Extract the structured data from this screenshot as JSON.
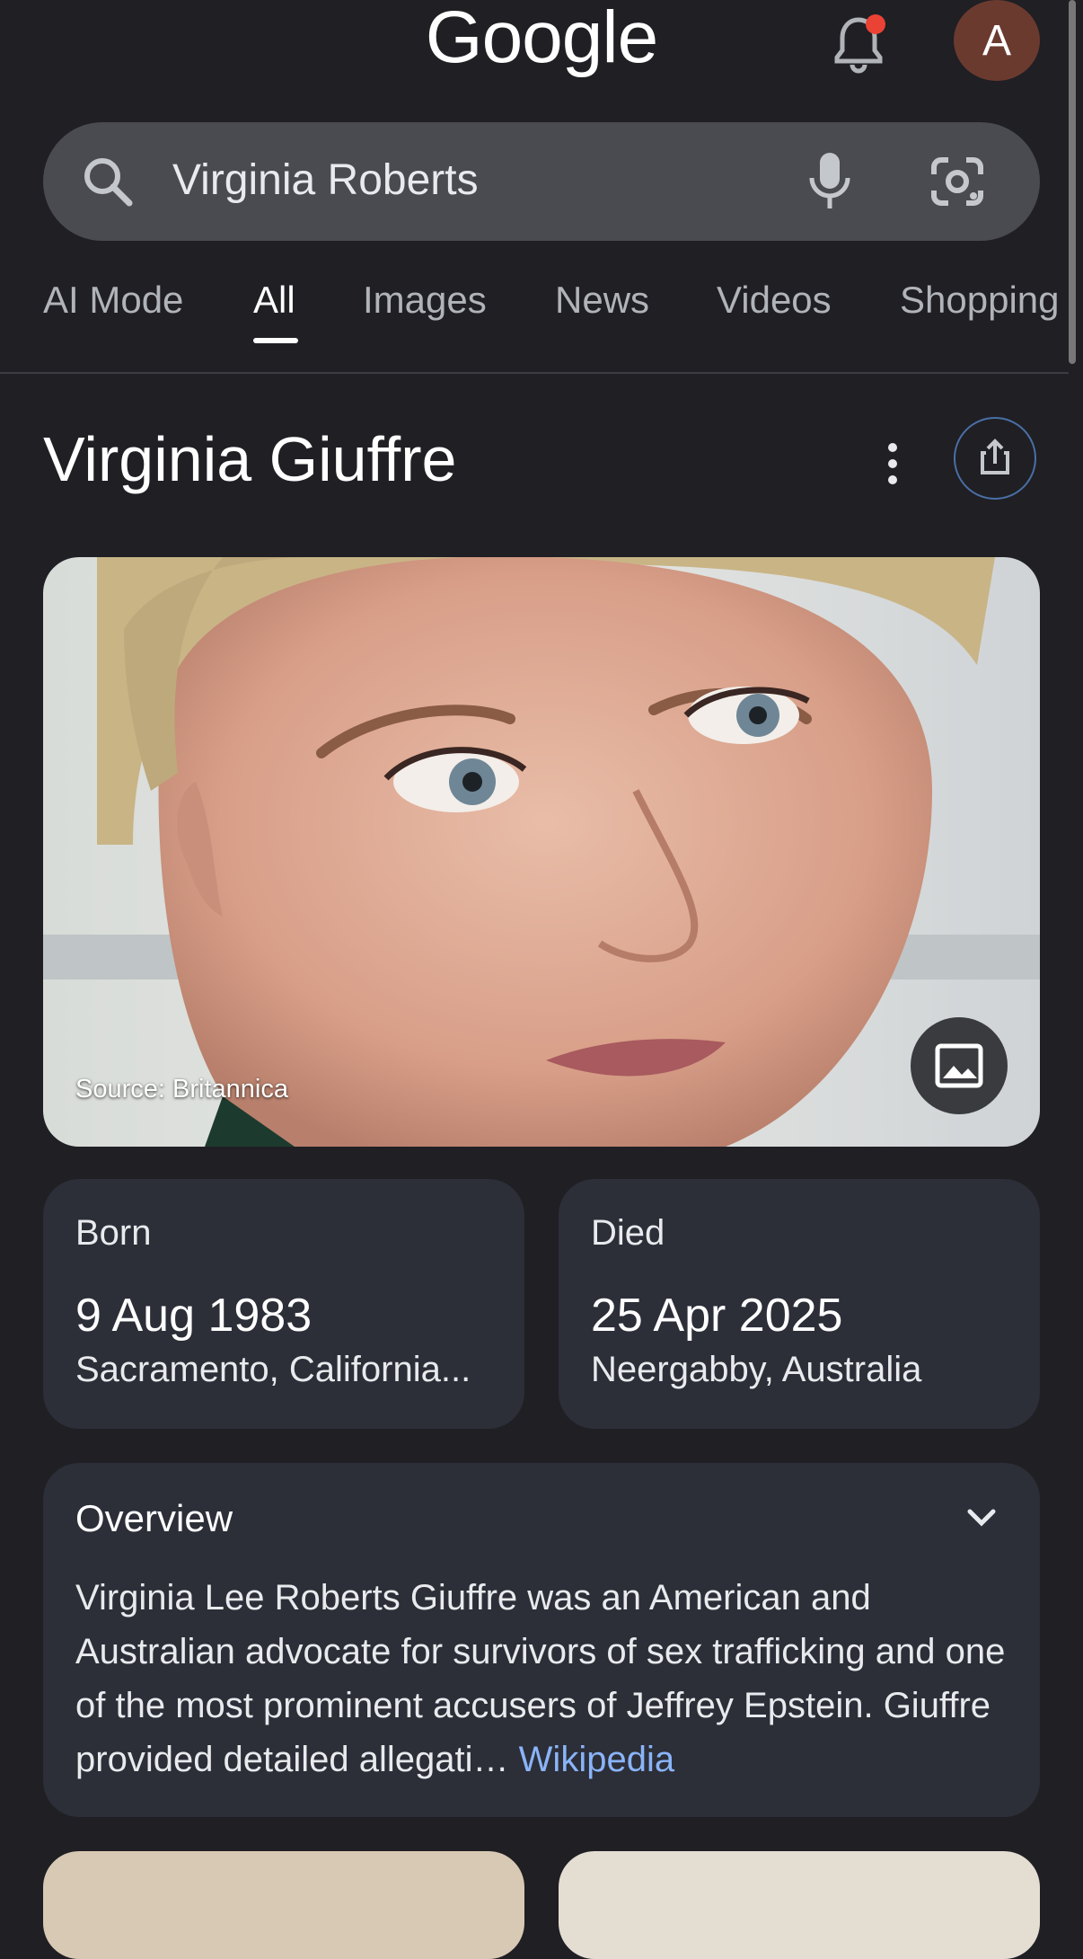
{
  "header": {
    "logo": "Google",
    "avatar_letter": "A"
  },
  "search": {
    "query": "Virginia Roberts"
  },
  "tabs": [
    {
      "label": "AI Mode"
    },
    {
      "label": "All",
      "active": true
    },
    {
      "label": "Images"
    },
    {
      "label": "News"
    },
    {
      "label": "Videos"
    },
    {
      "label": "Shopping"
    }
  ],
  "entity": {
    "title": "Virginia Giuffre",
    "image_source": "Source: Britannica"
  },
  "born": {
    "label": "Born",
    "date": "9 Aug 1983",
    "place": "Sacramento, California..."
  },
  "died": {
    "label": "Died",
    "date": "25 Apr 2025",
    "place": "Neergabby, Australia"
  },
  "overview": {
    "title": "Overview",
    "text": "Virginia Lee Roberts Giuffre was an American and Australian advocate for survivors of sex trafficking and one of the most prominent accusers of Jeffrey Epstein. Giuffre provided detailed allegati…",
    "link": "Wikipedia"
  },
  "colors": {
    "background": "#1f1f24",
    "card": "#2c2e38",
    "link": "#8ab4f8",
    "notification_dot": "#ea4335"
  }
}
